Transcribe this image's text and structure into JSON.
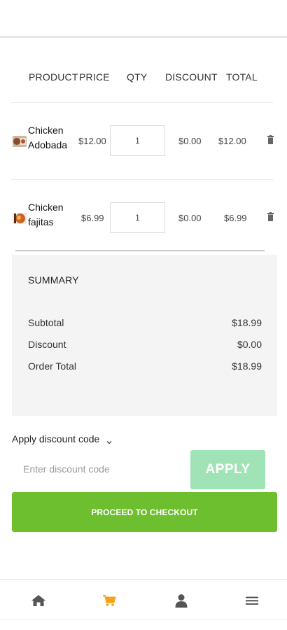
{
  "cart": {
    "headers": {
      "product": "PRODUCT",
      "price": "PRICE",
      "qty": "QTY",
      "discount": "DISCOUNT",
      "total": "TOTAL"
    },
    "items": [
      {
        "name": "Chicken Adobada",
        "price": "$12.00",
        "qty": "1",
        "discount": "$0.00",
        "total": "$12.00",
        "icon": "trash-icon"
      },
      {
        "name": "Chicken fajitas",
        "price": "$6.99",
        "qty": "1",
        "discount": "$0.00",
        "total": "$6.99",
        "icon": "trash-icon"
      }
    ]
  },
  "summary": {
    "title": "SUMMARY",
    "subtotal_label": "Subtotal",
    "subtotal_value": "$18.99",
    "discount_label": "Discount",
    "discount_value": "$0.00",
    "order_total_label": "Order Total",
    "order_total_value": "$18.99"
  },
  "discount_code": {
    "toggle_label": "Apply discount code",
    "input_placeholder": "Enter discount code",
    "input_value": "",
    "apply_label": "APPLY"
  },
  "checkout": {
    "label": "PROCEED TO CHECKOUT"
  },
  "bottom_nav": {
    "items": [
      {
        "icon": "home-icon",
        "active": false
      },
      {
        "icon": "cart-icon",
        "active": true
      },
      {
        "icon": "user-icon",
        "active": false
      },
      {
        "icon": "menu-icon",
        "active": false
      }
    ]
  },
  "colors": {
    "checkout_green": "#6ebf2f",
    "apply_green_light": "#9fe3b7",
    "active_nav_orange": "#f5a21b",
    "nav_gray": "#555555",
    "summary_bg": "#f4f4f4"
  }
}
